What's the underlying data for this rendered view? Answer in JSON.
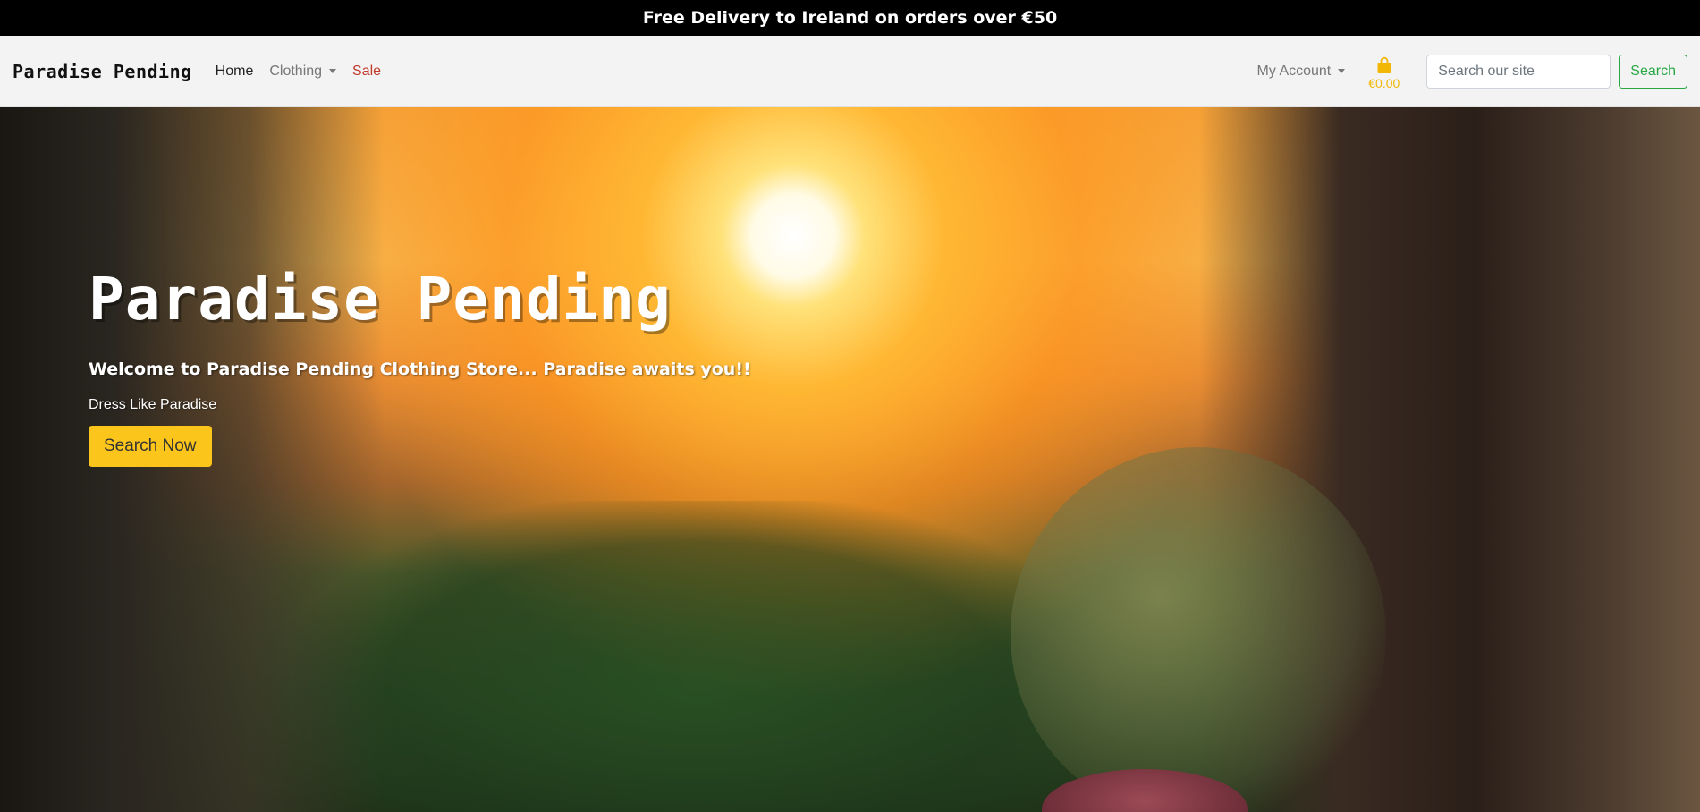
{
  "promo": {
    "text": "Free Delivery to Ireland on orders over €50"
  },
  "navbar": {
    "brand": "Paradise Pending",
    "links": {
      "home": "Home",
      "clothing": "Clothing",
      "sale": "Sale"
    },
    "account_label": "My Account",
    "cart_total": "€0.00",
    "search": {
      "placeholder": "Search our site",
      "value": "",
      "button_label": "Search"
    }
  },
  "hero": {
    "title": "Paradise Pending",
    "welcome": "Welcome to Paradise Pending Clothing Store... Paradise awaits you!!",
    "tagline": "Dress Like Paradise",
    "cta_label": "Search Now"
  },
  "colors": {
    "cart_accent": "#f2b705",
    "cta_background": "#fcc51b",
    "search_button": "#28a745",
    "sale_link": "#c0392b"
  },
  "icons": {
    "cart": "shopping-bag-icon",
    "dropdown": "caret-down-icon"
  }
}
